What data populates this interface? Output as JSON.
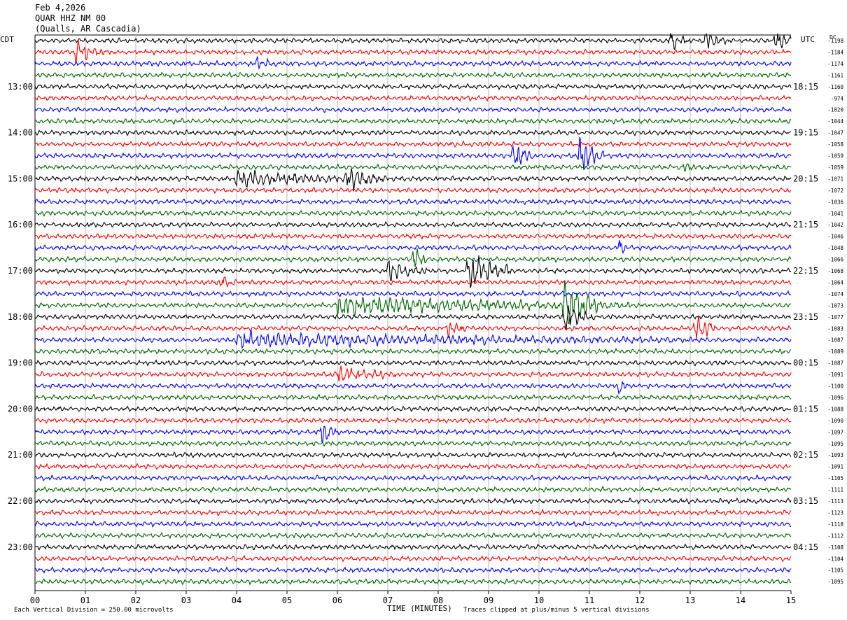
{
  "header": {
    "date": "Feb 4,2026",
    "station": "QUAR HHZ NM 00",
    "location": "(Qualls, AR Cascadia)"
  },
  "left_tz": "CDT",
  "right_tz": "UTC",
  "dc_label": "DC",
  "footer": {
    "vertical_division": "Each Vertical Division =  250.00 microvolts",
    "xlabel": "TIME (MINUTES)",
    "clip_note": "Traces clipped at plus/minus 5 vertical divisions"
  },
  "chart_data": {
    "type": "line",
    "title": "QUAR HHZ NM 00",
    "xlabel": "TIME (MINUTES)",
    "xlim": [
      0,
      15
    ],
    "x_ticks": [
      "00",
      "01",
      "02",
      "03",
      "04",
      "05",
      "06",
      "07",
      "08",
      "09",
      "10",
      "11",
      "12",
      "13",
      "14",
      "15"
    ],
    "grid": "vertical lines every minute",
    "trace_colors": [
      "#000000",
      "#ff0000",
      "#0000ff",
      "#006400"
    ],
    "traces_per_hour": 4,
    "trace_count": 48,
    "left_hour_labels": [
      "13:00",
      "14:00",
      "15:00",
      "16:00",
      "17:00",
      "18:00",
      "19:00",
      "20:00",
      "21:00",
      "22:00",
      "23:00"
    ],
    "right_hour_labels": [
      "18:15",
      "19:15",
      "20:15",
      "21:15",
      "22:15",
      "23:15",
      "00:15",
      "01:15",
      "02:15",
      "03:15",
      "04:15"
    ],
    "dc_offsets": [
      -1198,
      -1184,
      -1174,
      -1161,
      -1160,
      -974,
      -1020,
      -1044,
      -1047,
      -1058,
      -1059,
      -1059,
      -1071,
      -1072,
      -1036,
      -1041,
      -1042,
      -1046,
      -1048,
      -1066,
      -1068,
      -1064,
      -1074,
      -1073,
      -1077,
      -1083,
      -1087,
      -1089,
      -1087,
      -1091,
      -1100,
      -1096,
      -1088,
      -1090,
      -1097,
      -1095,
      -1093,
      -1091,
      -1105,
      -1111,
      -1113,
      -1123,
      -1118,
      -1112,
      -1108,
      -1104,
      -1105,
      -1095
    ],
    "events": [
      {
        "trace": 0,
        "t": 12.6,
        "amp": 2.4,
        "dur": 0.3
      },
      {
        "trace": 0,
        "t": 13.3,
        "amp": 2.0,
        "dur": 0.4
      },
      {
        "trace": 0,
        "t": 14.7,
        "amp": 2.8,
        "dur": 0.4
      },
      {
        "trace": 1,
        "t": 0.8,
        "amp": 1.8,
        "dur": 0.6
      },
      {
        "trace": 2,
        "t": 4.4,
        "amp": 1.2,
        "dur": 0.4
      },
      {
        "trace": 10,
        "t": 9.5,
        "amp": 2.8,
        "dur": 0.4
      },
      {
        "trace": 10,
        "t": 10.8,
        "amp": 4.0,
        "dur": 0.5
      },
      {
        "trace": 11,
        "t": 12.9,
        "amp": 1.2,
        "dur": 0.2
      },
      {
        "trace": 12,
        "t": 4.0,
        "amp": 1.5,
        "dur": 2.6
      },
      {
        "trace": 12,
        "t": 6.2,
        "amp": 2.4,
        "dur": 0.8
      },
      {
        "trace": 18,
        "t": 11.6,
        "amp": 1.6,
        "dur": 0.15
      },
      {
        "trace": 19,
        "t": 7.5,
        "amp": 2.4,
        "dur": 0.3
      },
      {
        "trace": 20,
        "t": 7.0,
        "amp": 2.2,
        "dur": 0.8
      },
      {
        "trace": 20,
        "t": 8.6,
        "amp": 4.0,
        "dur": 0.9
      },
      {
        "trace": 21,
        "t": 3.7,
        "amp": 1.2,
        "dur": 0.3
      },
      {
        "trace": 23,
        "t": 6.0,
        "amp": 1.8,
        "dur": 6.0
      },
      {
        "trace": 23,
        "t": 10.5,
        "amp": 4.5,
        "dur": 0.8
      },
      {
        "trace": 24,
        "t": 10.5,
        "amp": 3.0,
        "dur": 0.6
      },
      {
        "trace": 25,
        "t": 13.1,
        "amp": 4.5,
        "dur": 0.4
      },
      {
        "trace": 25,
        "t": 8.2,
        "amp": 1.5,
        "dur": 0.4
      },
      {
        "trace": 26,
        "t": 4.0,
        "amp": 1.3,
        "dur": 9.0
      },
      {
        "trace": 29,
        "t": 6.0,
        "amp": 1.4,
        "dur": 1.2
      },
      {
        "trace": 30,
        "t": 11.6,
        "amp": 2.4,
        "dur": 0.15
      },
      {
        "trace": 34,
        "t": 5.7,
        "amp": 2.6,
        "dur": 0.35
      }
    ]
  }
}
